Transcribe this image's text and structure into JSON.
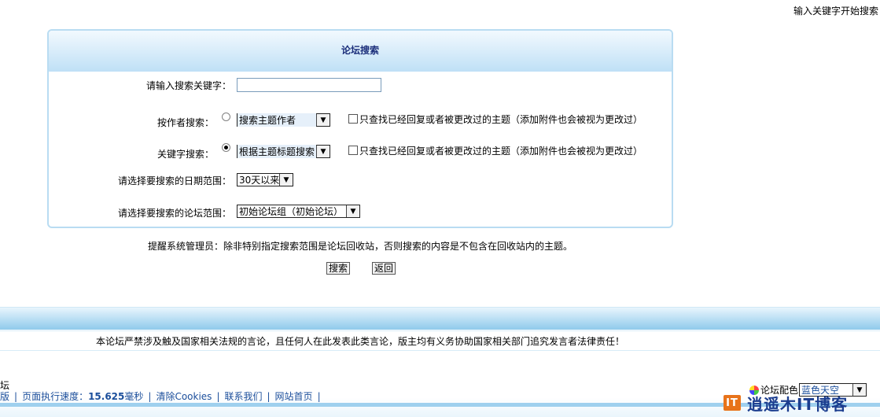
{
  "top_hint": "输入关键字开始搜索",
  "panel": {
    "title": "论坛搜索"
  },
  "form": {
    "keyword_label": "请输入搜索关键字：",
    "keyword_value": "",
    "author_label": "按作者搜索：",
    "author_select": "搜索主题作者",
    "author_checked": false,
    "keyword_search_label": "关键字搜索：",
    "keyword_select": "根据主题标题搜索",
    "keyword_search_checked": true,
    "checkbox_label": "只查找已经回复或者被更改过的主题（添加附件也会被视为更改过）",
    "date_label": "请选择要搜索的日期范围：",
    "date_select": "30天以来",
    "forum_label": "请选择要搜索的论坛范围：",
    "forum_select": "初始论坛组（初始论坛）"
  },
  "note": "提醒系统管理员：除非特别指定搜索范围是论坛回收站，否则搜索的内容是不包含在回收站内的主题。",
  "buttons": {
    "search": "搜索",
    "back": "返回"
  },
  "footer": {
    "notice": "本论坛严禁涉及触及国家相关法规的言论，且任何人在此发表此类言论，版主均有义务协助国家相关部门追究发言者法律责任！",
    "forum_cut": "坛",
    "version_cut": "版",
    "speed_prefix": "页面执行速度：",
    "speed_value": "15.625",
    "speed_unit": "毫秒",
    "clear_cookies": "清除Cookies",
    "contact": "联系我们",
    "home": "网站首页",
    "separator": "|",
    "theme_label": "论坛配色",
    "theme_select": "蓝色天空"
  },
  "watermark": {
    "logo": "IT",
    "text": "逍遥木IT博客"
  }
}
